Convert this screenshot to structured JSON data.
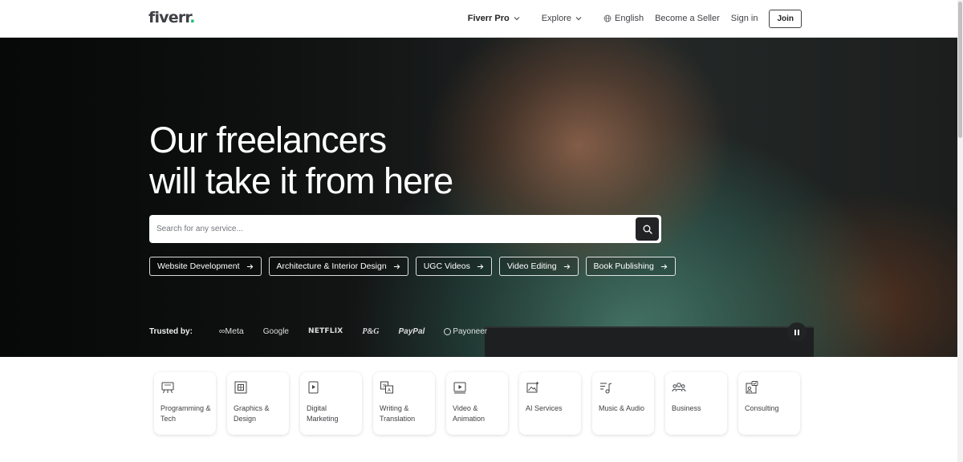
{
  "header": {
    "logo_text": "fiverr",
    "logo_dot": ".",
    "nav": {
      "fiverr_pro": "Fiverr Pro",
      "explore": "Explore",
      "language": "English",
      "become_seller": "Become a Seller",
      "sign_in": "Sign in",
      "join": "Join"
    }
  },
  "hero": {
    "title_line1": "Our freelancers",
    "title_line2": "will take it from here",
    "search": {
      "placeholder": "Search for any service..."
    },
    "pills": [
      "Website Development",
      "Architecture & Interior Design",
      "UGC Videos",
      "Video Editing",
      "Book Publishing"
    ],
    "trusted_label": "Trusted by:",
    "brands": {
      "meta": "Meta",
      "google": "Google",
      "netflix": "NETFLIX",
      "pg": "P&G",
      "paypal": "PayPal",
      "payoneer": "Payoneer"
    }
  },
  "categories": [
    {
      "label": "Programming & Tech",
      "icon": "programming-icon"
    },
    {
      "label": "Graphics & Design",
      "icon": "graphics-icon"
    },
    {
      "label": "Digital Marketing",
      "icon": "marketing-icon"
    },
    {
      "label": "Writing & Translation",
      "icon": "translation-icon"
    },
    {
      "label": "Video & Animation",
      "icon": "video-icon"
    },
    {
      "label": "AI Services",
      "icon": "ai-icon"
    },
    {
      "label": "Music & Audio",
      "icon": "music-icon"
    },
    {
      "label": "Business",
      "icon": "business-icon"
    },
    {
      "label": "Consulting",
      "icon": "consulting-icon"
    }
  ],
  "colors": {
    "brand_green": "#1dbf73",
    "text_dark": "#404145"
  }
}
